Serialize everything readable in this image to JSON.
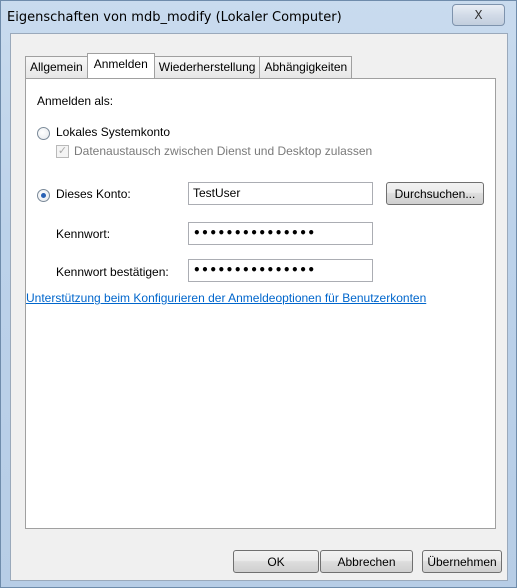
{
  "window": {
    "title": "Eigenschaften von mdb_modify (Lokaler Computer)",
    "close_glyph": "X"
  },
  "tabs": [
    {
      "label": "Allgemein",
      "active": false
    },
    {
      "label": "Anmelden",
      "active": true
    },
    {
      "label": "Wiederherstellung",
      "active": false
    },
    {
      "label": "Abhängigkeiten",
      "active": false
    }
  ],
  "logon": {
    "heading": "Anmelden als:",
    "local_system_label": "Lokales Systemkonto",
    "local_system_selected": false,
    "desktop_interact_label": "Datenaustausch zwischen Dienst und Desktop zulassen",
    "desktop_interact_checked": true,
    "this_account_label": "Dieses Konto:",
    "this_account_selected": true,
    "account_value": "TestUser",
    "browse_button": "Durchsuchen...",
    "password_label": "Kennwort:",
    "password_value": "•••••••••••••••",
    "confirm_label": "Kennwort bestätigen:",
    "confirm_value": "•••••••••••••••",
    "help_link": "Unterstützung beim Konfigurieren der Anmeldeoptionen für Benutzerkonten"
  },
  "buttons": {
    "ok": "OK",
    "cancel": "Abbrechen",
    "apply": "Übernehmen"
  },
  "colors": {
    "link": "#0066cc",
    "radio_dot": "#2a62b5"
  }
}
